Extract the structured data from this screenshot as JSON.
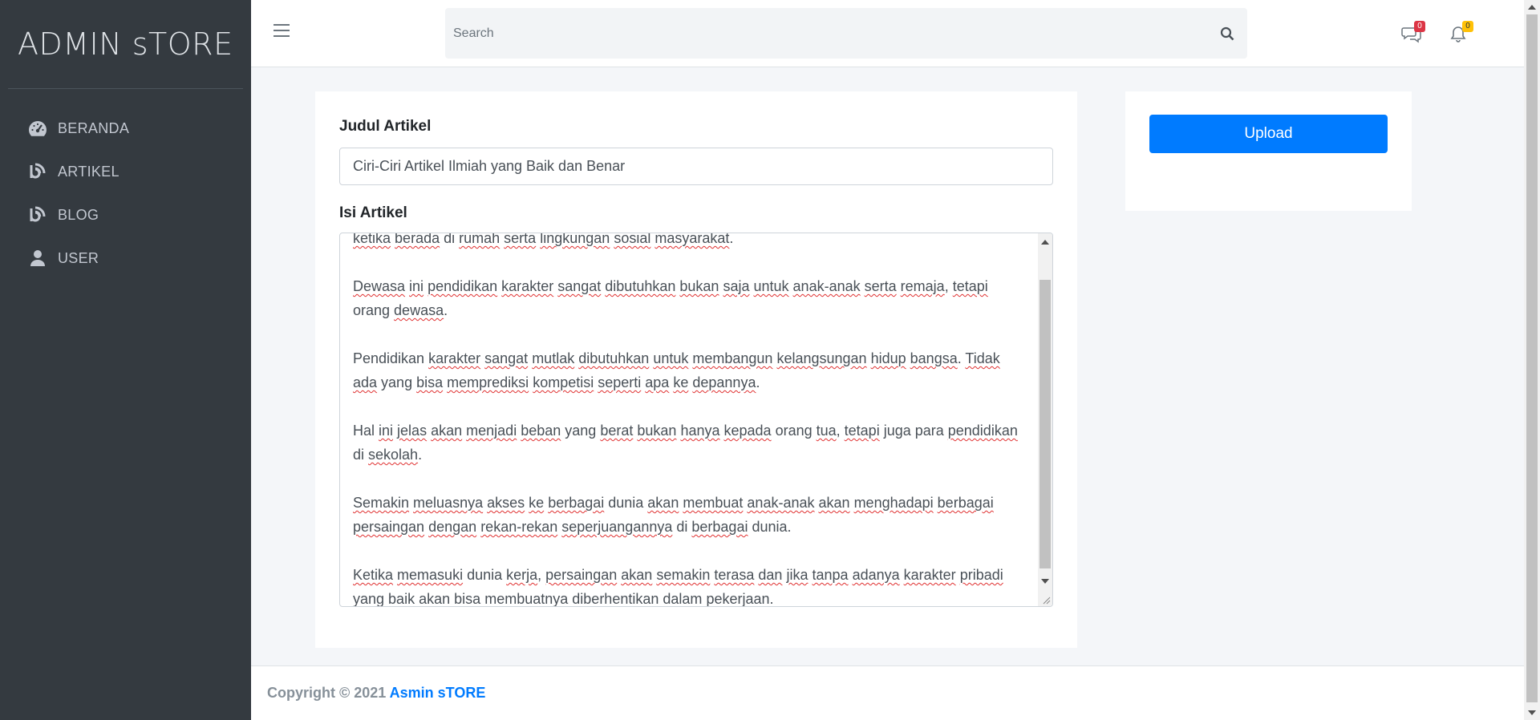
{
  "brand": "ADMIN sTORE",
  "sidebar": {
    "items": [
      {
        "label": "BERANDA",
        "icon": "tachometer-icon"
      },
      {
        "label": "ARTIKEL",
        "icon": "blog-icon"
      },
      {
        "label": "BLOG",
        "icon": "blog-icon"
      },
      {
        "label": "USER",
        "icon": "user-icon"
      }
    ]
  },
  "header": {
    "search_placeholder": "Search",
    "messages_count": "0",
    "notifications_count": "0"
  },
  "form": {
    "title_label": "Judul Artikel",
    "title_value": "Ciri-Ciri Artikel Ilmiah yang Baik dan Benar",
    "content_label": "Isi Artikel"
  },
  "actions": {
    "upload_label": "Upload"
  },
  "footer": {
    "copyright": "Copyright © 2021 ",
    "link": "Asmin sTORE"
  },
  "colors": {
    "sidebar": "#343a40",
    "primary": "#007bff",
    "badge_red": "#dc3545",
    "badge_yellow": "#ffc107"
  }
}
